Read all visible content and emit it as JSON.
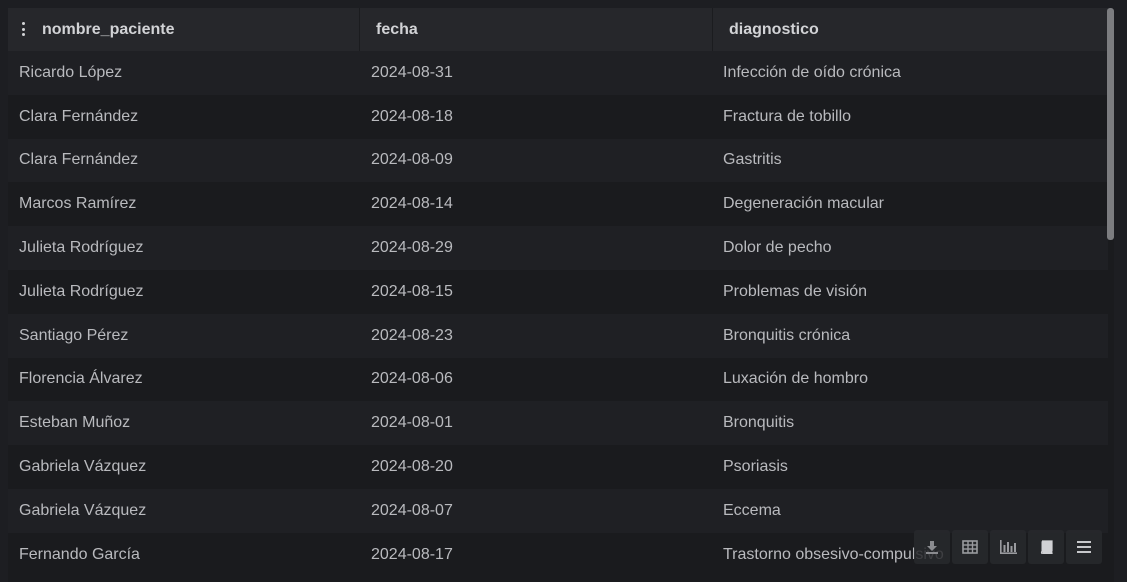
{
  "table": {
    "columns": [
      "nombre_paciente",
      "fecha",
      "diagnostico"
    ],
    "rows": [
      [
        "Ricardo López",
        "2024-08-31",
        "Infección de oído crónica"
      ],
      [
        "Clara Fernández",
        "2024-08-18",
        "Fractura de tobillo"
      ],
      [
        "Clara Fernández",
        "2024-08-09",
        "Gastritis"
      ],
      [
        "Marcos Ramírez",
        "2024-08-14",
        "Degeneración macular"
      ],
      [
        "Julieta Rodríguez",
        "2024-08-29",
        "Dolor de pecho"
      ],
      [
        "Julieta Rodríguez",
        "2024-08-15",
        "Problemas de visión"
      ],
      [
        "Santiago Pérez",
        "2024-08-23",
        "Bronquitis crónica"
      ],
      [
        "Florencia Álvarez",
        "2024-08-06",
        "Luxación de hombro"
      ],
      [
        "Esteban Muñoz",
        "2024-08-01",
        "Bronquitis"
      ],
      [
        "Gabriela Vázquez",
        "2024-08-20",
        "Psoriasis"
      ],
      [
        "Gabriela Vázquez",
        "2024-08-07",
        "Eccema"
      ],
      [
        "Fernando García",
        "2024-08-17",
        "Trastorno obsesivo-compulsivo"
      ]
    ]
  },
  "toolbar": {
    "icons": [
      "download-icon",
      "table-icon",
      "bar-chart-icon",
      "book-icon",
      "menu-icon"
    ]
  },
  "colors": {
    "background": "#1a1b1e",
    "header": "#26272b",
    "row_alt": "#1f2024",
    "text": "#b9babe",
    "header_text": "#d2d3d6"
  }
}
